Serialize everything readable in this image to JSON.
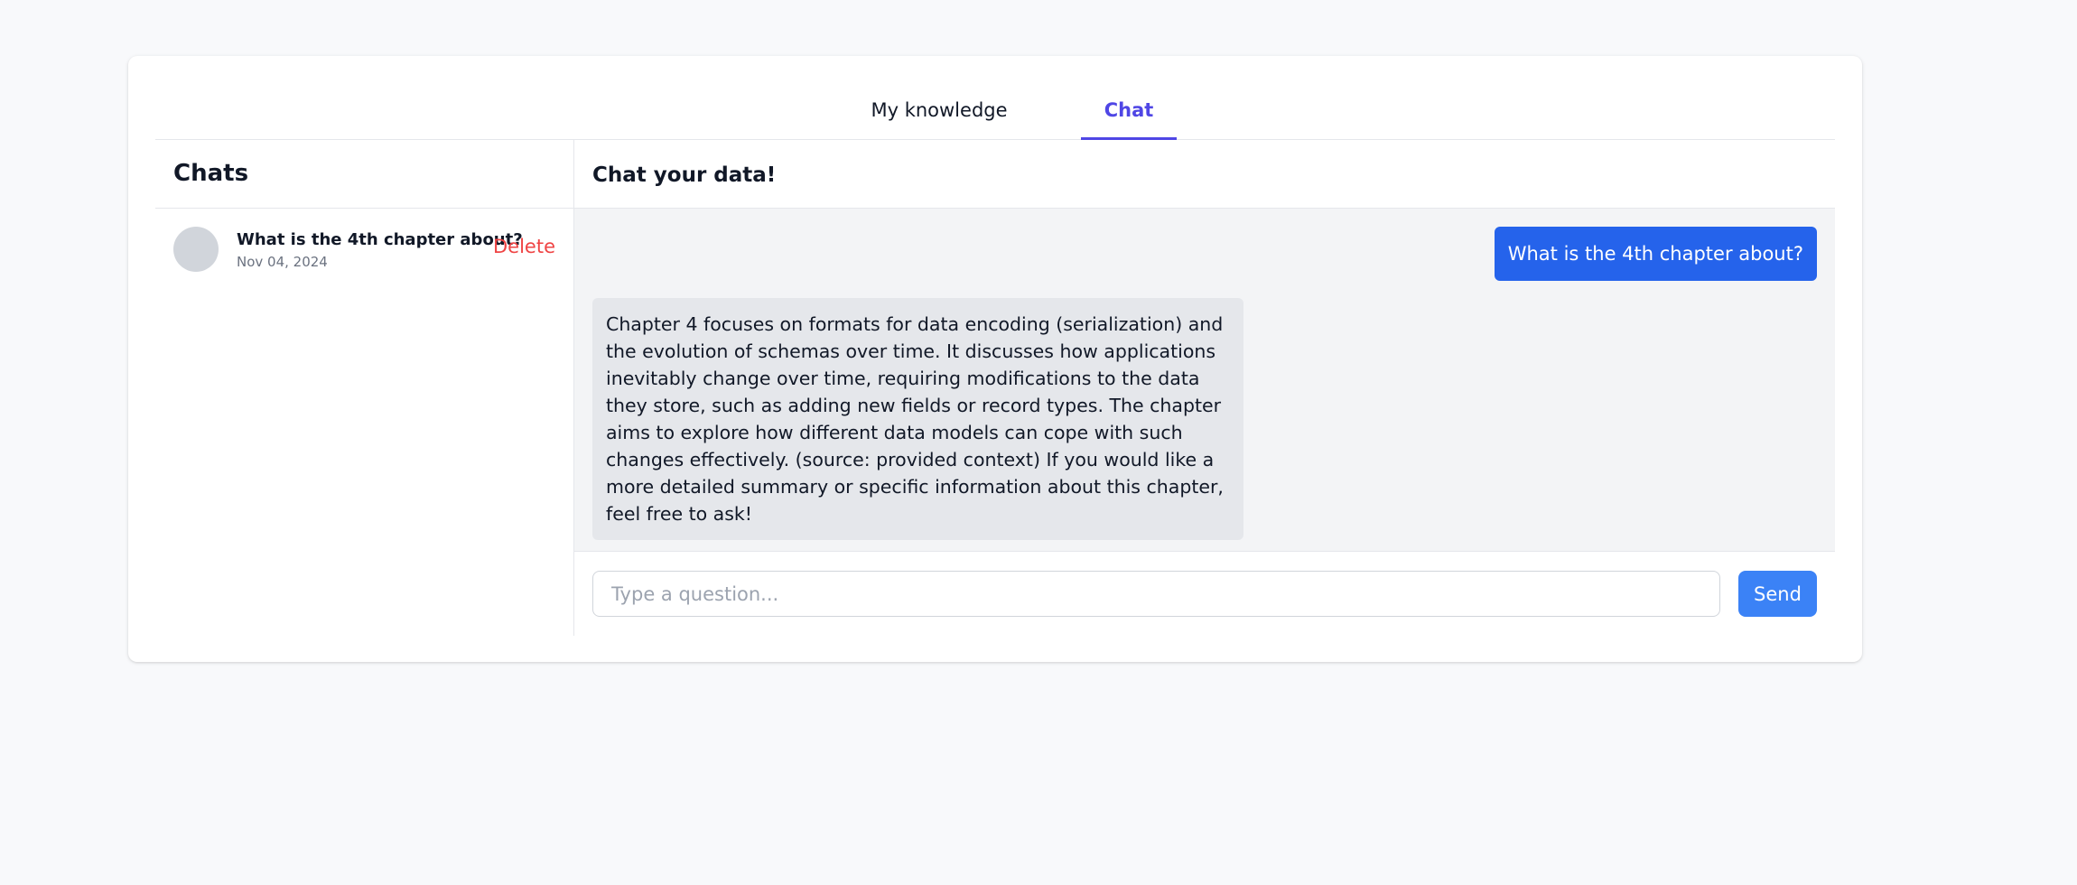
{
  "tabs": {
    "knowledge_label": "My knowledge",
    "chat_label": "Chat",
    "active": "Chat"
  },
  "sidebar": {
    "title": "Chats",
    "items": [
      {
        "title": "What is the 4th chapter about?",
        "date": "Nov 04, 2024",
        "delete_label": "Delete"
      }
    ]
  },
  "main": {
    "title": "Chat your data!",
    "messages": [
      {
        "role": "user",
        "text": "What is the 4th chapter about?"
      },
      {
        "role": "assistant",
        "text": "Chapter 4 focuses on formats for data encoding (serialization) and the evolution of schemas over time. It discusses how applications inevitably change over time, requiring modifications to the data they store, such as adding new fields or record types. The chapter aims to explore how different data models can cope with such changes effectively. (source: provided context) If you would like a more detailed summary or specific information about this chapter, feel free to ask!"
      }
    ],
    "composer": {
      "value": "",
      "placeholder": "Type a question...",
      "send_label": "Send"
    }
  },
  "colors": {
    "accent": "#4f46e5",
    "user_bubble": "#2563eb",
    "send_button": "#3b82f6",
    "delete": "#ef4444",
    "messages_bg": "#f3f4f6",
    "assistant_bubble": "#e5e7eb"
  }
}
